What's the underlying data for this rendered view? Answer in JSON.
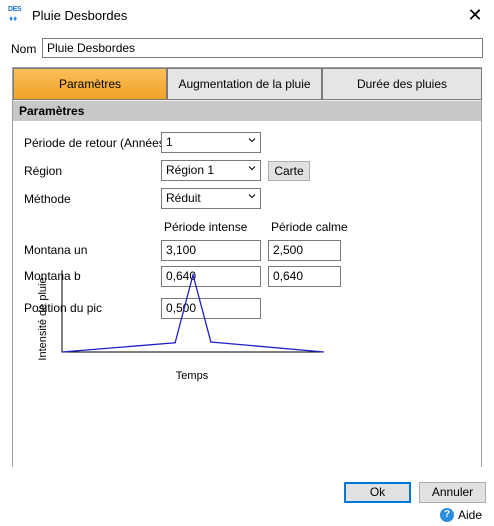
{
  "window": {
    "title": "Pluie Desbordes",
    "icon_name": "des-rain-app-icon",
    "icon_text": "DES"
  },
  "nom": {
    "label": "Nom",
    "value": "Pluie Desbordes"
  },
  "tabs": [
    {
      "label": "Paramètres",
      "active": true
    },
    {
      "label": "Augmentation de la pluie",
      "active": false
    },
    {
      "label": "Durée des pluies",
      "active": false
    }
  ],
  "group": {
    "title": "Paramètres"
  },
  "form": {
    "periode_retour": {
      "label": "Période de retour (Années)",
      "value": "1"
    },
    "region": {
      "label": "Région",
      "value": "Région 1",
      "map_button": "Carte"
    },
    "methode": {
      "label": "Méthode",
      "value": "Réduit"
    },
    "column_headers": {
      "intense": "Période intense",
      "calme": "Période calme"
    },
    "montana_a": {
      "label": "Montana un",
      "intense": "3,100",
      "calme": "2,500"
    },
    "montana_b": {
      "label": "Montana b",
      "intense": "0,640",
      "calme": "0,640"
    },
    "position_pic": {
      "label": "Position du pic",
      "value": "0,500"
    }
  },
  "chart_data": {
    "type": "line",
    "xlabel": "Temps",
    "ylabel": "Intensité de pluie",
    "grid": false,
    "line_color": "#2020c8",
    "x": [
      0,
      0.38,
      0.44,
      0.5,
      0.88
    ],
    "y": [
      0,
      0.12,
      1.0,
      0.13,
      0
    ],
    "xlim": [
      0,
      0.88
    ],
    "ylim": [
      0,
      1.05
    ]
  },
  "footer": {
    "ok_label": "Ok",
    "cancel_label": "Annuler",
    "help_label": "Aide"
  },
  "colors": {
    "active_tab": "#f5ad3a",
    "group_header": "#c8c8c8",
    "focus_border": "#0078d7"
  }
}
